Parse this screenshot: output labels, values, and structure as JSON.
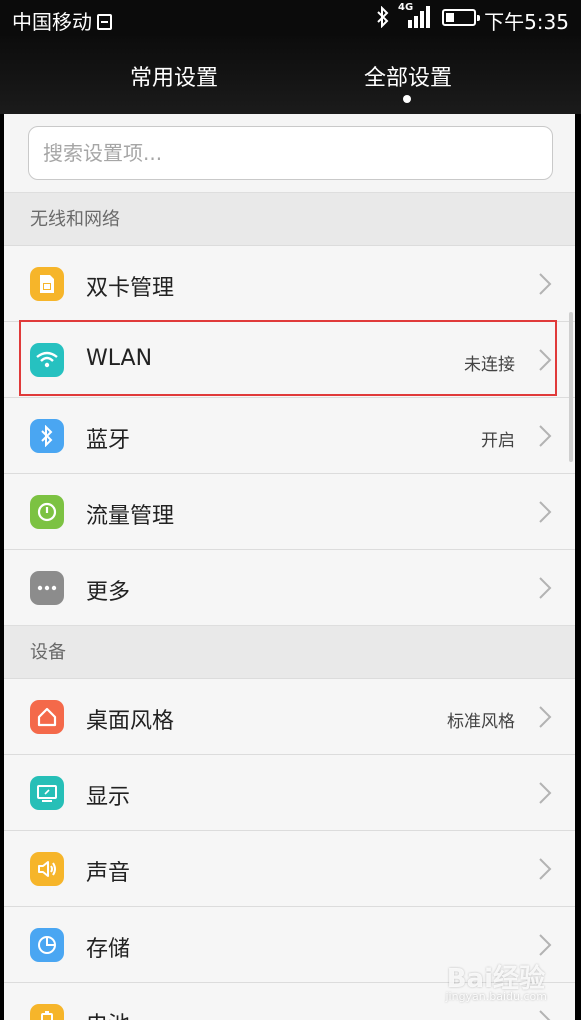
{
  "status_bar": {
    "carrier": "中国移动",
    "network_tag": "4G",
    "time": "下午5:35"
  },
  "tabs": [
    {
      "label": "常用设置",
      "active": false
    },
    {
      "label": "全部设置",
      "active": true
    }
  ],
  "search": {
    "placeholder": "搜索设置项...",
    "value": ""
  },
  "sections": [
    {
      "title": "无线和网络",
      "items": [
        {
          "label": "双卡管理",
          "value": "",
          "icon": "dual-sim-icon",
          "color": "#f6b52a"
        },
        {
          "label": "WLAN",
          "value": "未连接",
          "icon": "wifi-icon",
          "color": "#26c1c0"
        },
        {
          "label": "蓝牙",
          "value": "开启",
          "icon": "bluetooth-icon",
          "color": "#4aa6f2"
        },
        {
          "label": "流量管理",
          "value": "",
          "icon": "data-usage-icon",
          "color": "#7cc242"
        },
        {
          "label": "更多",
          "value": "",
          "icon": "more-icon",
          "color": "#8c8c8c"
        }
      ]
    },
    {
      "title": "设备",
      "items": [
        {
          "label": "桌面风格",
          "value": "标准风格",
          "icon": "home-icon",
          "color": "#f4694a"
        },
        {
          "label": "显示",
          "value": "",
          "icon": "display-icon",
          "color": "#26bfb7"
        },
        {
          "label": "声音",
          "value": "",
          "icon": "sound-icon",
          "color": "#f6b52a"
        },
        {
          "label": "存储",
          "value": "",
          "icon": "storage-icon",
          "color": "#4aa6f2"
        },
        {
          "label": "电池",
          "value": "",
          "icon": "battery-icon",
          "color": "#f6b52a"
        }
      ]
    }
  ],
  "watermark": {
    "text": "Bai经验",
    "sub": "jingyan.baidu.com"
  }
}
